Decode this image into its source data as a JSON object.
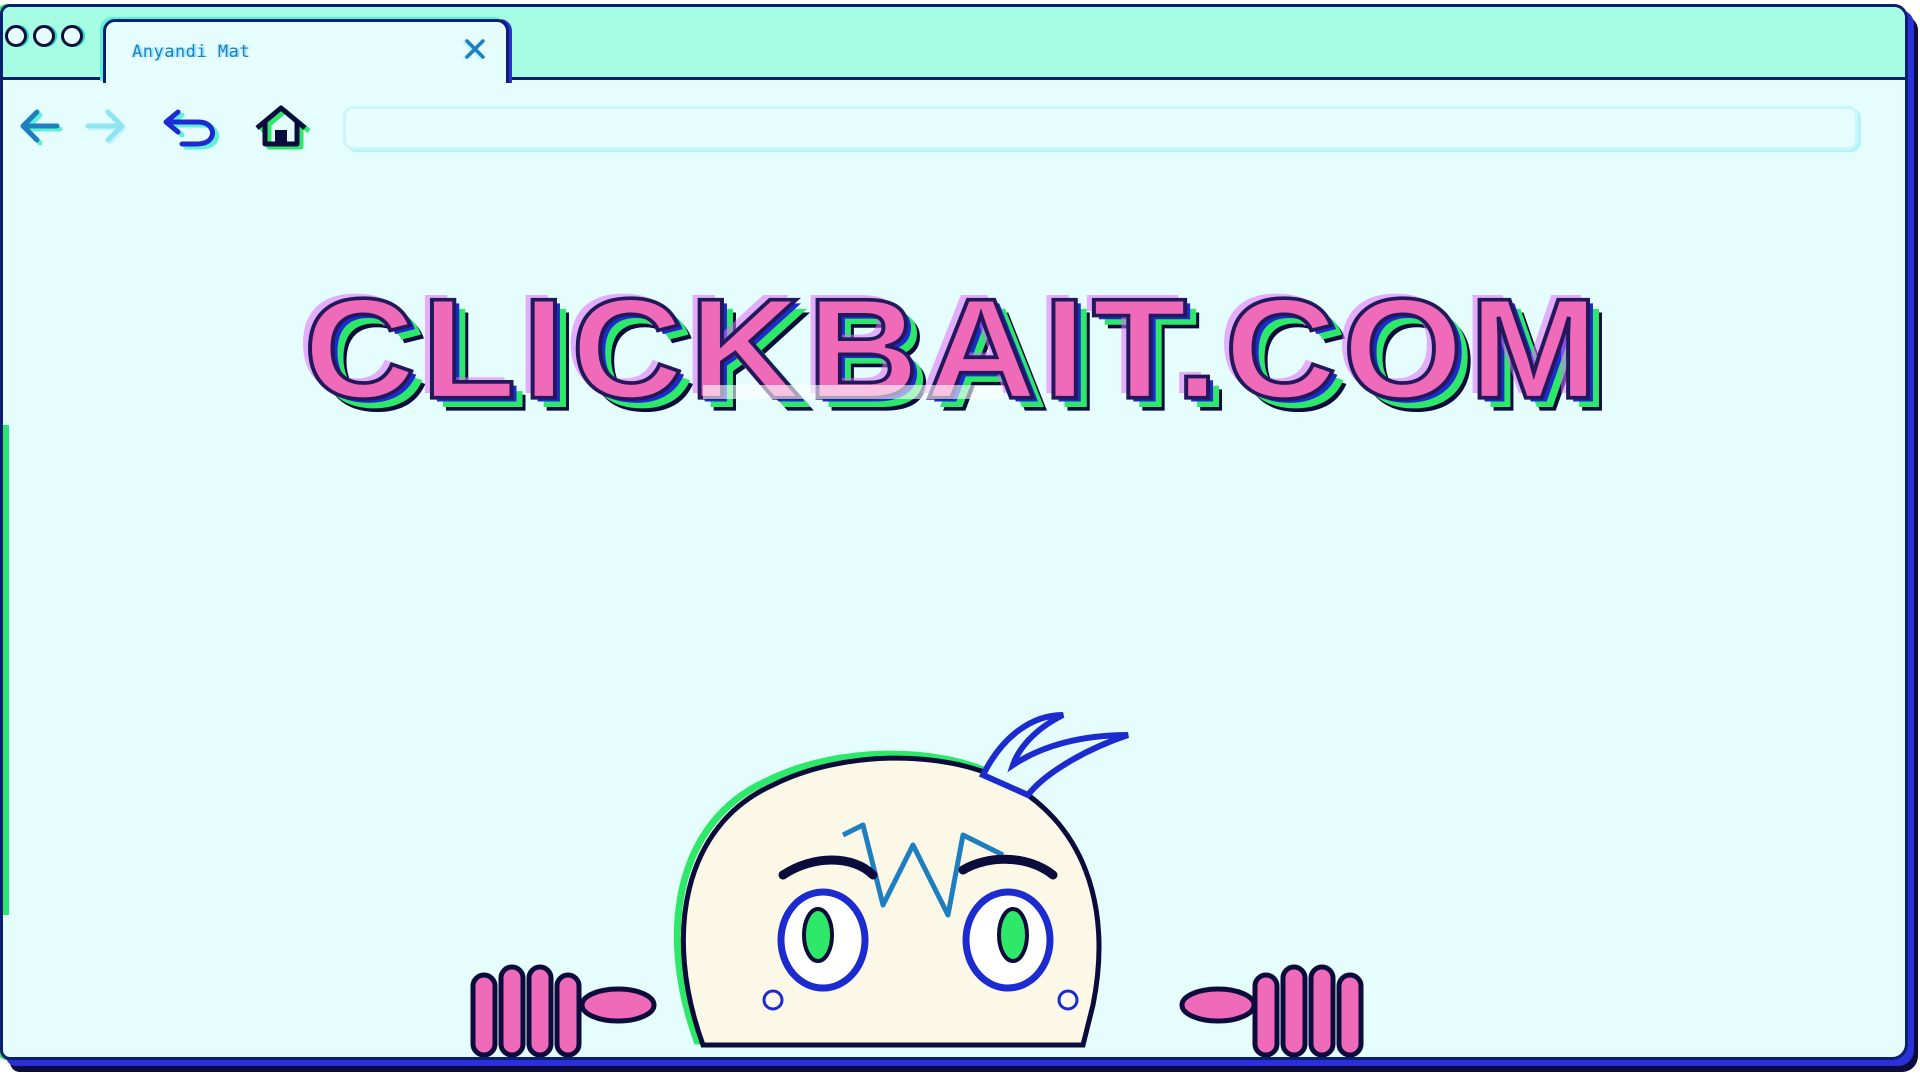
{
  "browser": {
    "tab": {
      "title": "Anyandi Mat"
    },
    "toolbar": {
      "address_value": ""
    },
    "colors": {
      "chrome": "#a6fde4",
      "page": "#e6fdfd",
      "outline": "#0a1f6e",
      "accent_blue": "#1d7fc0",
      "headline_pink": "#f06aba"
    }
  },
  "page": {
    "headline": "CLICKBAIT.COM"
  },
  "icons": {
    "close": "close-icon",
    "back": "arrow-left-icon",
    "forward": "arrow-right-icon",
    "reload": "undo-icon",
    "home": "home-icon"
  }
}
